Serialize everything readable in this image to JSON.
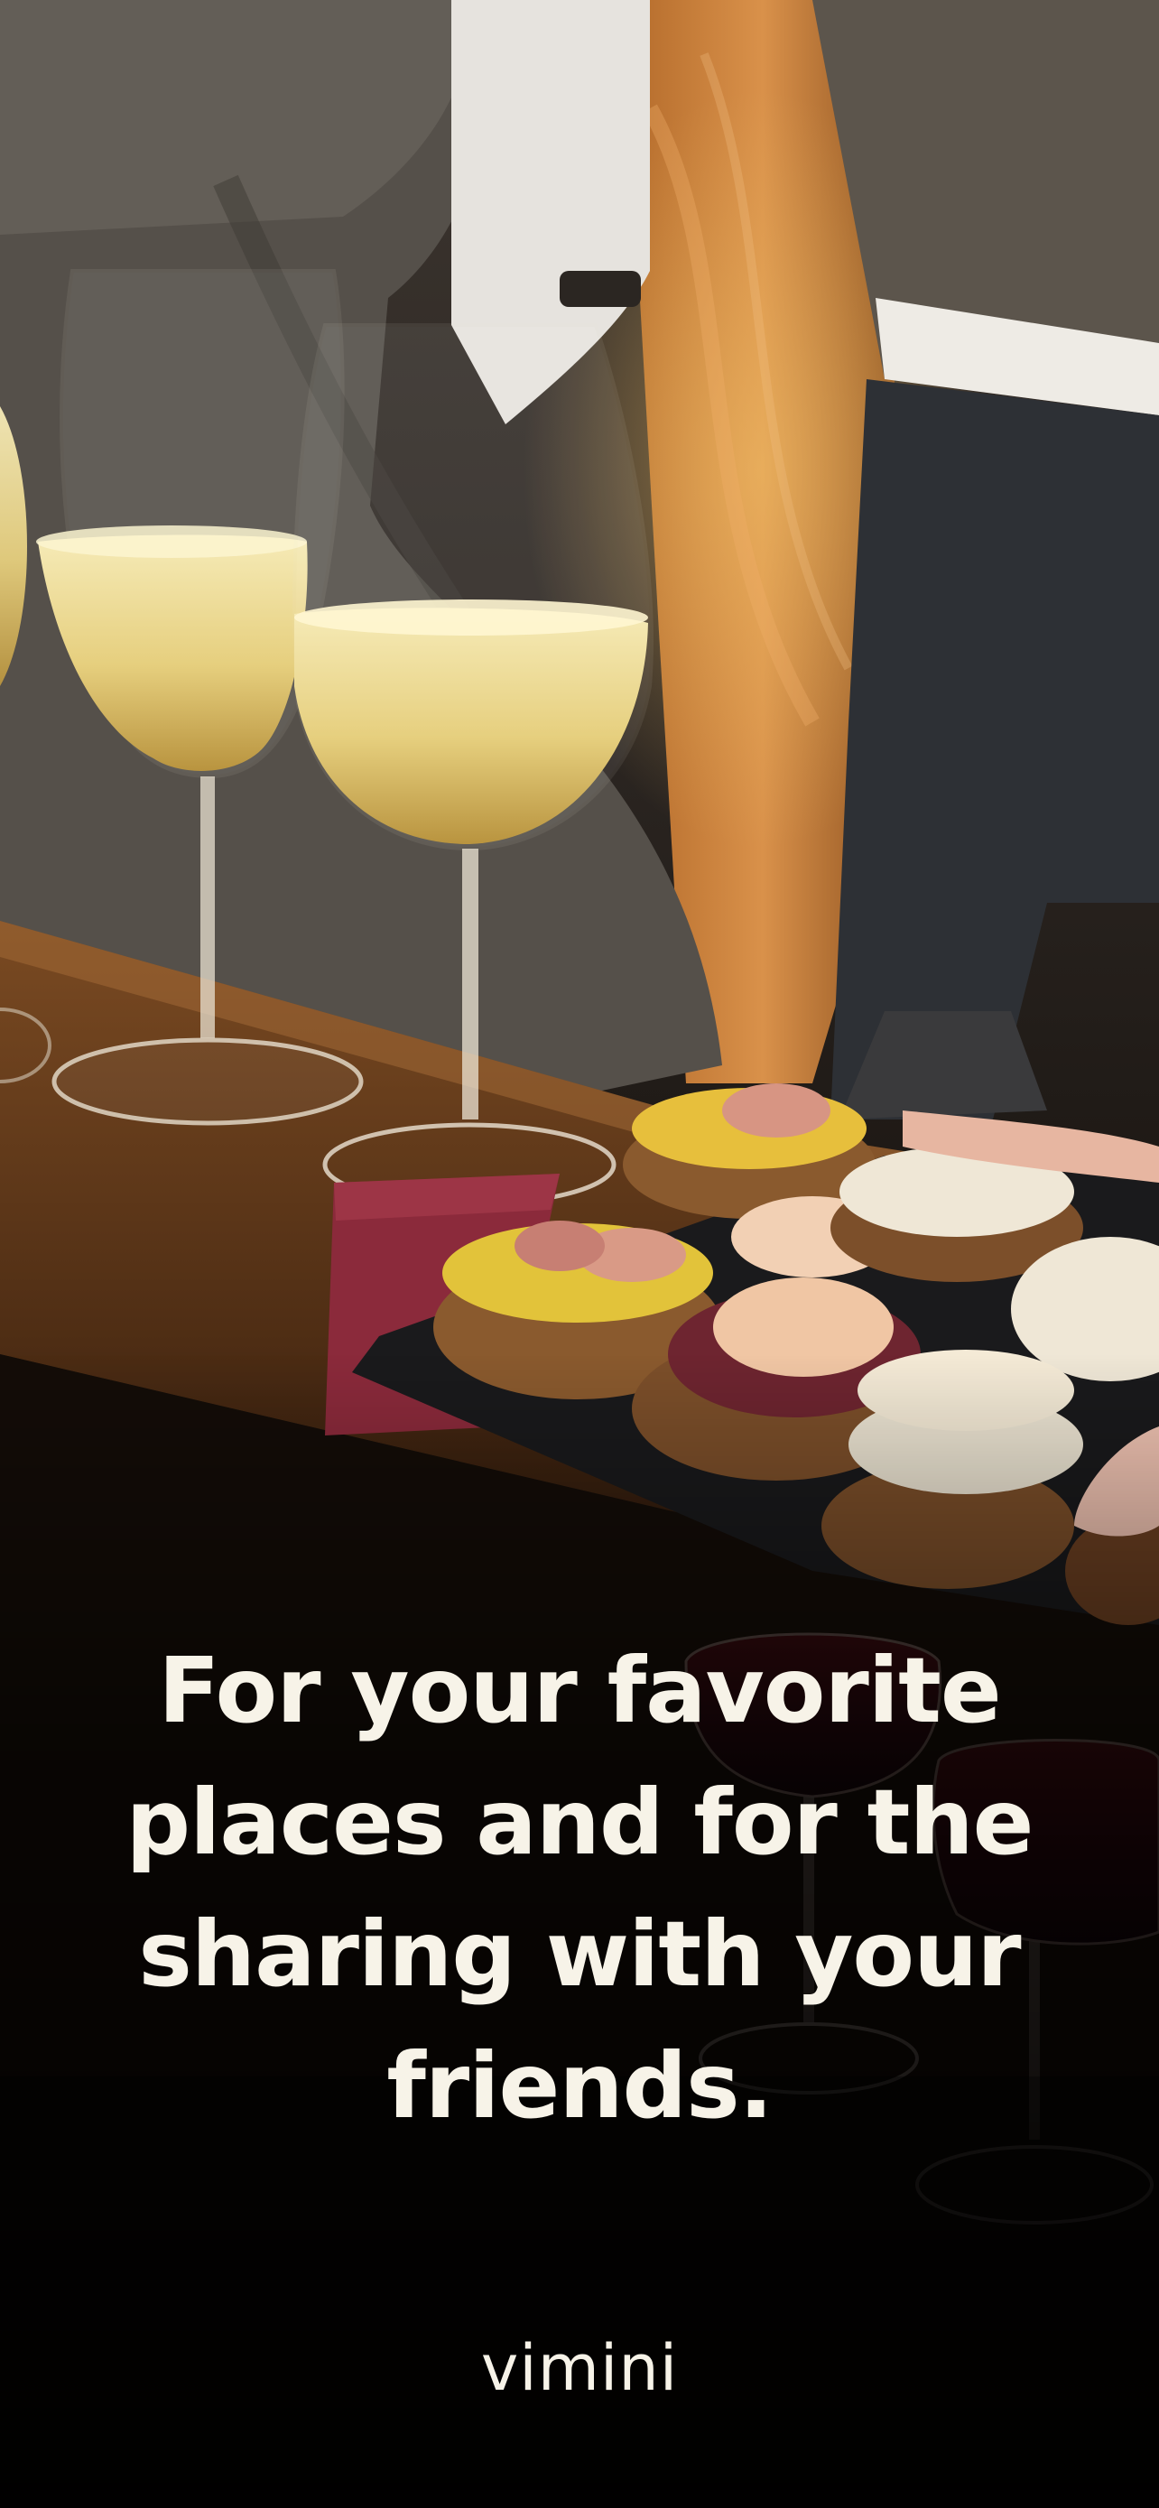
{
  "onboarding": {
    "headline": "For your favorite places and for the sharing with your friends.",
    "brand_name": "vimini"
  },
  "colors": {
    "text": "#f7f3e8",
    "background": "#000000",
    "wine": "#f1e3a6",
    "wood": "#8a5526"
  }
}
